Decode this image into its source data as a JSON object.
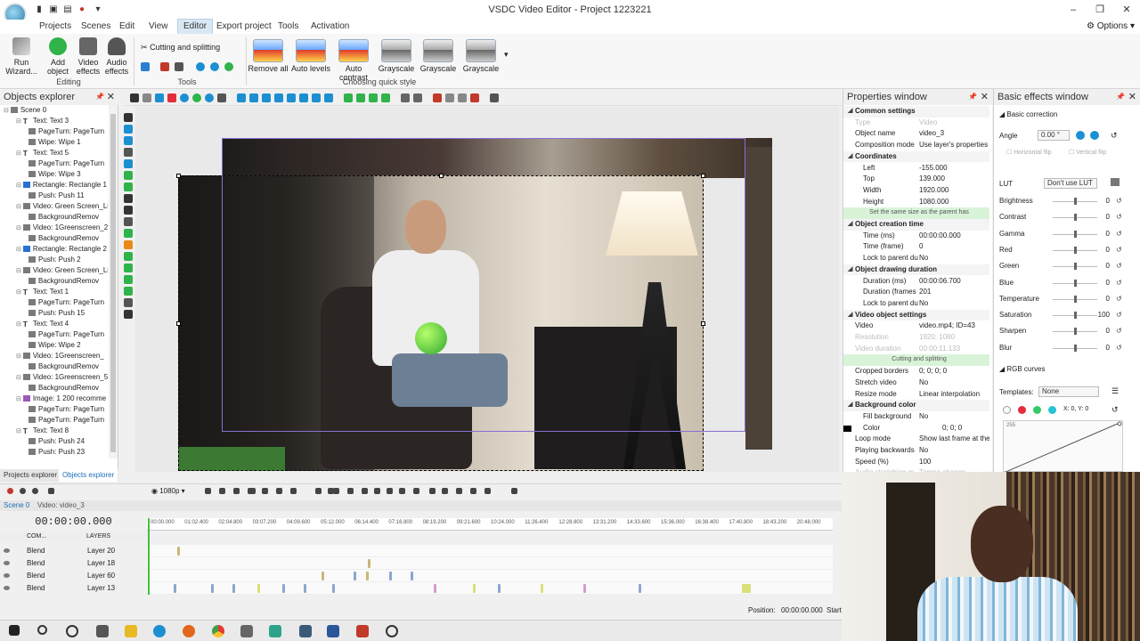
{
  "app": {
    "title": "VSDC Video Editor - Project 1223221",
    "options_label": "Options"
  },
  "menu": {
    "items": [
      "Projects",
      "Scenes",
      "Edit",
      "View",
      "Editor",
      "Export project",
      "Tools",
      "Activation"
    ],
    "active": "Editor"
  },
  "ribbon": {
    "editing": {
      "run_wizard": "Run Wizard...",
      "add_object": "Add object",
      "video_effects": "Video effects",
      "audio_effects": "Audio effects",
      "group_label": "Editing"
    },
    "tools": {
      "cutting_splitting": "Cutting and splitting",
      "group_label": "Tools"
    },
    "quick_style": {
      "items": [
        "Remove all",
        "Auto levels",
        "Auto contrast",
        "Grayscale",
        "Grayscale",
        "Grayscale"
      ],
      "group_label": "Choosing quick style"
    }
  },
  "objects_explorer": {
    "title": "Objects explorer",
    "tree": [
      {
        "label": "Scene 0",
        "level": 0,
        "icon": "scene"
      },
      {
        "label": "Text: Text 3",
        "level": 1,
        "icon": "text"
      },
      {
        "label": "PageTurn: PageTurn",
        "level": 2,
        "icon": "effect"
      },
      {
        "label": "Wipe: Wipe 1",
        "level": 2,
        "icon": "effect"
      },
      {
        "label": "Text: Text 5",
        "level": 1,
        "icon": "text"
      },
      {
        "label": "PageTurn: PageTurn",
        "level": 2,
        "icon": "effect"
      },
      {
        "label": "Wipe: Wipe 3",
        "level": 2,
        "icon": "effect"
      },
      {
        "label": "Rectangle: Rectangle 1",
        "level": 1,
        "icon": "rect"
      },
      {
        "label": "Push: Push 11",
        "level": 2,
        "icon": "effect"
      },
      {
        "label": "Video: Green Screen_Li",
        "level": 1,
        "icon": "video"
      },
      {
        "label": "BackgroundRemov",
        "level": 2,
        "icon": "effect"
      },
      {
        "label": "Video: 1Greenscreen_2",
        "level": 1,
        "icon": "video"
      },
      {
        "label": "BackgroundRemov",
        "level": 2,
        "icon": "effect"
      },
      {
        "label": "Rectangle: Rectangle 2",
        "level": 1,
        "icon": "rect"
      },
      {
        "label": "Push: Push 2",
        "level": 2,
        "icon": "effect"
      },
      {
        "label": "Video: Green Screen_Li",
        "level": 1,
        "icon": "video"
      },
      {
        "label": "BackgroundRemov",
        "level": 2,
        "icon": "effect"
      },
      {
        "label": "Text: Text 1",
        "level": 1,
        "icon": "text"
      },
      {
        "label": "PageTurn: PageTurn",
        "level": 2,
        "icon": "effect"
      },
      {
        "label": "Push: Push 15",
        "level": 2,
        "icon": "effect"
      },
      {
        "label": "Text: Text 4",
        "level": 1,
        "icon": "text"
      },
      {
        "label": "PageTurn: PageTurn",
        "level": 2,
        "icon": "effect"
      },
      {
        "label": "Wipe: Wipe 2",
        "level": 2,
        "icon": "effect"
      },
      {
        "label": "Video: 1Greenscreen_",
        "level": 1,
        "icon": "video"
      },
      {
        "label": "BackgroundRemov",
        "level": 2,
        "icon": "effect"
      },
      {
        "label": "Video: 1Greenscreen_5",
        "level": 1,
        "icon": "video"
      },
      {
        "label": "BackgroundRemov",
        "level": 2,
        "icon": "effect"
      },
      {
        "label": "Image: 1 200 recomme",
        "level": 1,
        "icon": "img"
      },
      {
        "label": "PageTurn: PageTurn",
        "level": 2,
        "icon": "effect"
      },
      {
        "label": "PageTurn: PageTurn",
        "level": 2,
        "icon": "effect"
      },
      {
        "label": "Text: Text 8",
        "level": 1,
        "icon": "text"
      },
      {
        "label": "Push: Push 24",
        "level": 2,
        "icon": "effect"
      },
      {
        "label": "Push: Push 23",
        "level": 2,
        "icon": "effect"
      }
    ],
    "tabs": [
      "Projects explorer",
      "Objects explorer"
    ],
    "active_tab": "Objects explorer"
  },
  "properties": {
    "title": "Properties window",
    "rows": [
      {
        "type": "hdr",
        "k": "Common settings"
      },
      {
        "type": "dis",
        "k": "Type",
        "v": "Video"
      },
      {
        "type": "row",
        "k": "Object name",
        "v": "video_3"
      },
      {
        "type": "row",
        "k": "Composition mode",
        "v": "Use layer's properties"
      },
      {
        "type": "hdr",
        "k": "Coordinates"
      },
      {
        "type": "sub",
        "k": "Left",
        "v": "-155.000"
      },
      {
        "type": "sub",
        "k": "Top",
        "v": "139.000"
      },
      {
        "type": "sub",
        "k": "Width",
        "v": "1920.000"
      },
      {
        "type": "sub",
        "k": "Height",
        "v": "1080.000"
      },
      {
        "type": "btn",
        "k": "Set the same size as the parent has"
      },
      {
        "type": "hdr",
        "k": "Object creation time"
      },
      {
        "type": "sub",
        "k": "Time (ms)",
        "v": "00:00:00.000"
      },
      {
        "type": "sub",
        "k": "Time (frame)",
        "v": "0"
      },
      {
        "type": "sub",
        "k": "Lock to parent du",
        "v": "No"
      },
      {
        "type": "hdr",
        "k": "Object drawing duration"
      },
      {
        "type": "sub",
        "k": "Duration (ms)",
        "v": "00:00:06.700"
      },
      {
        "type": "sub",
        "k": "Duration (frames",
        "v": "201"
      },
      {
        "type": "sub",
        "k": "Lock to parent du",
        "v": "No"
      },
      {
        "type": "hdr",
        "k": "Video object settings"
      },
      {
        "type": "row",
        "k": "Video",
        "v": "video.mp4; ID=43"
      },
      {
        "type": "dis",
        "k": "Resolution",
        "v": "1920; 1080"
      },
      {
        "type": "dis",
        "k": "Video duration",
        "v": "00:00:11.133"
      },
      {
        "type": "btn",
        "k": "Cutting and splitting"
      },
      {
        "type": "row",
        "k": "Cropped borders",
        "v": "0; 0; 0; 0"
      },
      {
        "type": "row",
        "k": "Stretch video",
        "v": "No"
      },
      {
        "type": "row",
        "k": "Resize mode",
        "v": "Linear interpolation"
      },
      {
        "type": "hdr",
        "k": "Background color"
      },
      {
        "type": "sub",
        "k": "Fill background",
        "v": "No"
      },
      {
        "type": "sub",
        "k": "Color",
        "v": "0; 0; 0"
      },
      {
        "type": "row",
        "k": "Loop mode",
        "v": "Show last frame at the"
      },
      {
        "type": "row",
        "k": "Playing backwards",
        "v": "No"
      },
      {
        "type": "row",
        "k": "Speed (%)",
        "v": "100"
      },
      {
        "type": "dis",
        "k": "Audio stretching m",
        "v": "Tempo change"
      }
    ]
  },
  "effects": {
    "title": "Basic effects window",
    "section": "Basic correction",
    "angle_label": "Angle",
    "angle_value": "0.00 °",
    "hflip": "Horizontal flip",
    "vflip": "Vertical flip",
    "lut_label": "LUT",
    "lut_value": "Don't use LUT",
    "sliders": [
      {
        "label": "Brightness",
        "value": "0",
        "level": 0.5
      },
      {
        "label": "Contrast",
        "value": "0",
        "level": 0.5
      },
      {
        "label": "Gamma",
        "value": "0",
        "level": 0.5
      },
      {
        "label": "Red",
        "value": "0",
        "level": 0.5
      },
      {
        "label": "Green",
        "value": "0",
        "level": 0.5
      },
      {
        "label": "Blue",
        "value": "0",
        "level": 0.5
      },
      {
        "label": "Temperature",
        "value": "0",
        "level": 0.5
      },
      {
        "label": "Saturation",
        "value": "100",
        "level": 0.5
      },
      {
        "label": "Sharpen",
        "value": "0",
        "level": 0.5
      },
      {
        "label": "Blur",
        "value": "0",
        "level": 0.5
      }
    ],
    "rgb_curves": "RGB curves",
    "templates_label": "Templates:",
    "templates_value": "None",
    "xy_readout": "X: 0, Y: 0",
    "curve_max": "255"
  },
  "timeline": {
    "quality": "1080p",
    "tabs": [
      "Scene 0",
      "Video: video_3"
    ],
    "timecode": "00:00:00.000",
    "ruler": [
      "00:00.000",
      "01:02.400",
      "02:04.800",
      "03:07.200",
      "04:09.600",
      "05:12.000",
      "06:14.400",
      "07:16.800",
      "08:19.200",
      "09:21.600",
      "10:24.000",
      "11:26.400",
      "12:28.800",
      "13:31.200",
      "14:33.600",
      "15:36.000",
      "16:38.400",
      "17:40.800",
      "18:43.200",
      "20:48.000"
    ],
    "header_label": "COM...",
    "layers_label": "LAYERS",
    "layers": [
      {
        "blend": "Blend",
        "name": "Layer 20"
      },
      {
        "blend": "Blend",
        "name": "Layer 18"
      },
      {
        "blend": "Blend",
        "name": "Layer 60"
      },
      {
        "blend": "Blend",
        "name": "Layer 13"
      }
    ]
  },
  "status": {
    "position_label": "Position:",
    "position_value": "00:00:00.000",
    "start_label": "Start"
  },
  "colors": {
    "accent": "#2b7fb0",
    "playhead": "#3fbf3f",
    "selection": "#8a6fd0",
    "highlight_green": "#d9f3d9"
  }
}
